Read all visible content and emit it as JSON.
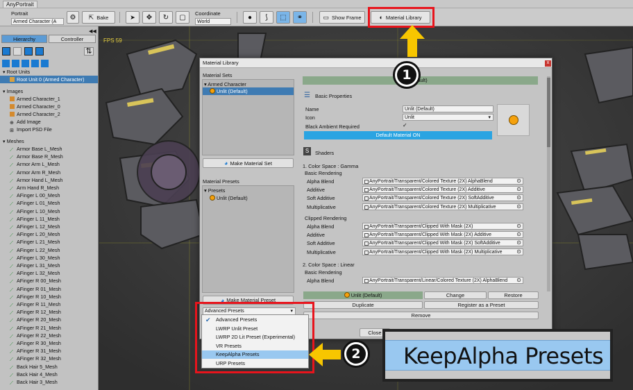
{
  "app": {
    "tab_title": "AnyPortrait"
  },
  "toolbar": {
    "portrait_label": "Portrait",
    "portrait_value": "Armed Character (A",
    "bake_label": "Bake",
    "coordinate_label": "Coordinate",
    "coordinate_value": "World",
    "show_frame_label": "Show Frame",
    "material_library_label": "Material Library"
  },
  "left_panel": {
    "tabs": [
      "Hierarchy",
      "Controller"
    ],
    "root_units_header": "Root Units",
    "root_unit": "Root Unit 0 (Armed Character)",
    "images_header": "Images",
    "images": [
      "Armed Character_1",
      "Armed Character_0",
      "Armed Character_2"
    ],
    "add_image": "Add Image",
    "import_psd": "Import PSD File",
    "meshes_header": "Meshes",
    "meshes": [
      "Armor Base L_Mesh",
      "Armor Base R_Mesh",
      "Armor Arm L_Mesh",
      "Armor Arm R_Mesh",
      "Armor Hand L_Mesh",
      "Arm Hand R_Mesh",
      "AFinger L 00_Mesh",
      "AFinger L 01_Mesh",
      "AFinger L 10_Mesh",
      "AFinger L 11_Mesh",
      "AFinger L 12_Mesh",
      "AFinger L 20_Mesh",
      "AFinger L 21_Mesh",
      "AFinger L 22_Mesh",
      "AFinger L 30_Mesh",
      "AFinger L 31_Mesh",
      "AFinger L 32_Mesh",
      "AFinger R 00_Mesh",
      "AFinger R 01_Mesh",
      "AFinger R 10_Mesh",
      "AFinger R 11_Mesh",
      "AFinger R 12_Mesh",
      "AFinger R 20_Mesh",
      "AFinger R 21_Mesh",
      "AFinger R 22_Mesh",
      "AFinger R 30_Mesh",
      "AFinger R 31_Mesh",
      "AFinger R 32_Mesh",
      "Back Hair 5_Mesh",
      "Back Hair 4_Mesh",
      "Back Hair 3_Mesh"
    ]
  },
  "viewport": {
    "fps": "FPS 59"
  },
  "dialog": {
    "title": "Material Library",
    "close_x": "x",
    "material_sets_label": "Material Sets",
    "set_group": "Armed Character",
    "set_item": "Unlit (Default)",
    "make_set_button": "Make Material Set",
    "material_presets_label": "Material Presets",
    "preset_group": "Presets",
    "preset_item": "Unlit (Default)",
    "make_preset_button": "Make Material Preset",
    "preset_dropdown": "Advanced Presets",
    "header_bar_text": "efault)",
    "basic_properties": "Basic Properties",
    "name_label": "Name",
    "name_value": "Unlit (Default)",
    "icon_label": "Icon",
    "icon_value": "Unlit",
    "black_ambient_label": "Black Ambient Required",
    "black_ambient_check": "✓",
    "default_material_button": "Default Material ON",
    "shaders_label": "Shaders",
    "gamma_label": "1. Color Space : Gamma",
    "linear_label": "2. Color Space : Linear",
    "basic_rendering": "Basic Rendering",
    "clipped_rendering": "Clipped Rendering",
    "gamma_basic": [
      {
        "mode": "Alpha Blend",
        "shader": "AnyPortrait/Transparent/Colored Texture (2X) AlphaBlend"
      },
      {
        "mode": "Additive",
        "shader": "AnyPortrait/Transparent/Colored Texture (2X) Additive"
      },
      {
        "mode": "Soft Additive",
        "shader": "AnyPortrait/Transparent/Colored Texture (2X) SoftAdditive"
      },
      {
        "mode": "Multiplicative",
        "shader": "AnyPortrait/Transparent/Colored Texture (2X) Multiplicative"
      }
    ],
    "gamma_clipped": [
      {
        "mode": "Alpha Blend",
        "shader": "AnyPortrait/Transparent/Clipped With Mask (2X)"
      },
      {
        "mode": "Additive",
        "shader": "AnyPortrait/Transparent/Clipped With Mask (2X) Additive"
      },
      {
        "mode": "Soft Additive",
        "shader": "AnyPortrait/Transparent/Clipped With Mask (2X) SoftAdditive"
      },
      {
        "mode": "Multiplicative",
        "shader": "AnyPortrait/Transparent/Clipped With Mask (2X) Multiplicative"
      }
    ],
    "linear_basic": [
      {
        "mode": "Alpha Blend",
        "shader": "AnyPortrait/Transparent/Linear/Colored Texture (2X) AlphaBlend"
      }
    ],
    "selected_label": "Unlit (Default)",
    "change_button": "Change",
    "restore_button": "Restore",
    "duplicate_button": "Duplicate",
    "register_preset_button": "Register as a Preset",
    "remove_button": "Remove",
    "close_button": "Close"
  },
  "preset_menu": {
    "items": [
      "Advanced Presets",
      "LWRP Unlit Preset",
      "LWRP 2D Lit Preset (Experimental)",
      "VR Presets",
      "KeepAlpha Presets",
      "URP Presets"
    ],
    "checked_index": 0,
    "highlighted_index": 4
  },
  "annotations": {
    "step1": "1",
    "step2": "2",
    "zoom_text": "KeepAlpha Presets"
  },
  "colors": {
    "highlight_red": "#e8141c",
    "arrow_yellow": "#f7c600",
    "selection_blue": "#3e7bb3",
    "menu_highlight": "#99c8f0",
    "header_green": "#8aa88a"
  }
}
